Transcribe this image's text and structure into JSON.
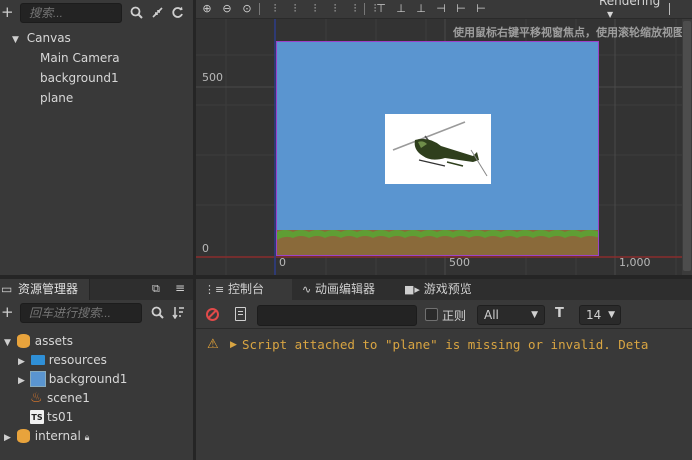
{
  "hierarchy": {
    "search_placeholder": "搜索...",
    "tree": [
      {
        "label": "Canvas",
        "indent": 0,
        "expanded": true
      },
      {
        "label": "Main Camera",
        "indent": 1
      },
      {
        "label": "background1",
        "indent": 1
      },
      {
        "label": "plane",
        "indent": 1
      }
    ]
  },
  "scene": {
    "hint": "使用鼠标右键平移视窗焦点，使用滚轮缩放视图",
    "rendering_label": "Rendering",
    "y_labels": [
      "500",
      "0"
    ],
    "x_labels": [
      "0",
      "500",
      "1,000"
    ],
    "sky_color": "#5a95d0",
    "grass_color": "#5f9e34",
    "dirt_color": "#8a6a3a",
    "frame_color": "#9b42c9"
  },
  "assets": {
    "tab_label": "资源管理器",
    "search_placeholder": "回车进行搜索...",
    "tree": [
      {
        "label": "assets",
        "icon": "db-icon",
        "expanded": true
      },
      {
        "label": "resources",
        "icon": "folder-icon"
      },
      {
        "label": "background1",
        "icon": "image-icon"
      },
      {
        "label": "scene1",
        "icon": "fire-icon"
      },
      {
        "label": "ts01",
        "icon": "ts-icon"
      },
      {
        "label": "internal",
        "icon": "db-icon"
      }
    ]
  },
  "console": {
    "tabs": [
      "控制台",
      "动画编辑器",
      "游戏预览"
    ],
    "regex_label": "正则",
    "level_value": "All",
    "font_size_value": "14",
    "log_message": "Script attached to \"plane\" is missing or invalid. Deta"
  }
}
